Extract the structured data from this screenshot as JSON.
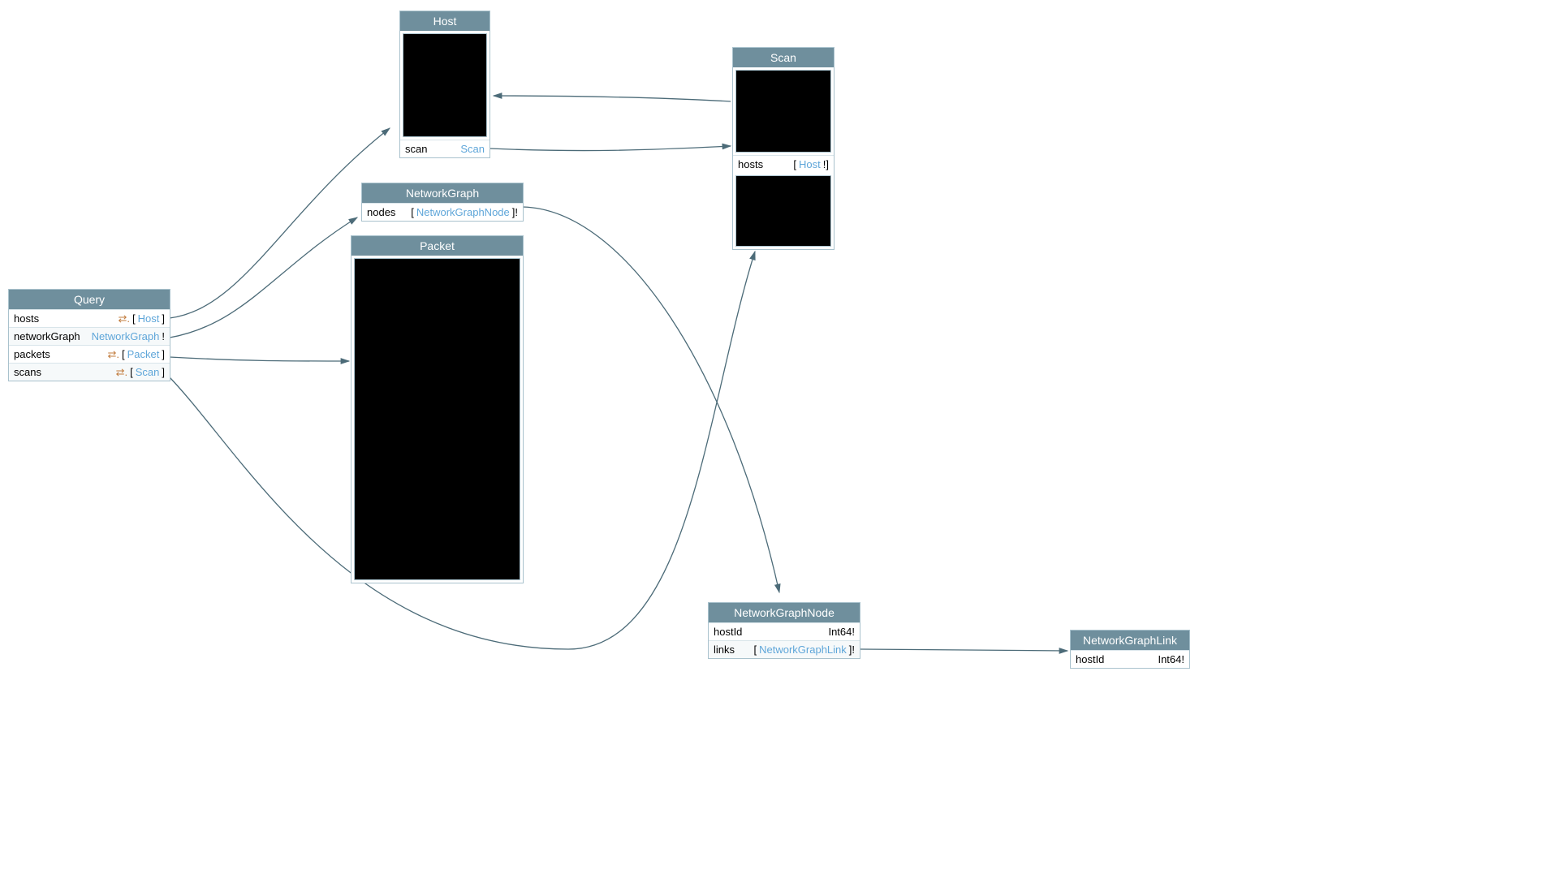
{
  "colors": {
    "header_bg": "#6f8f9d",
    "border": "#a9c2cd",
    "type_link": "#5fa6d9",
    "relay_icon": "#c27c3e",
    "edge": "#4c6b78"
  },
  "nodes": {
    "query": {
      "title": "Query",
      "fields": [
        {
          "name": "hosts",
          "relay": true,
          "type": "Host",
          "wrap": "[ ]"
        },
        {
          "name": "networkGraph",
          "relay": false,
          "type": "NetworkGraph",
          "suffix": "!"
        },
        {
          "name": "packets",
          "relay": true,
          "type": "Packet",
          "wrap": "[ ]"
        },
        {
          "name": "scans",
          "relay": true,
          "type": "Scan",
          "wrap": "[ ]"
        }
      ]
    },
    "host": {
      "title": "Host",
      "fields": [
        {
          "name": "scan",
          "type": "Scan"
        }
      ]
    },
    "scan": {
      "title": "Scan",
      "fields": [
        {
          "name": "hosts",
          "type": "Host",
          "wrap": "[ !]"
        }
      ]
    },
    "networkGraph": {
      "title": "NetworkGraph",
      "fields": [
        {
          "name": "nodes",
          "type": "NetworkGraphNode",
          "wrap": "[ ]!"
        }
      ]
    },
    "packet": {
      "title": "Packet"
    },
    "networkGraphNode": {
      "title": "NetworkGraphNode",
      "fields": [
        {
          "name": "hostId",
          "type_plain": "Int64!"
        },
        {
          "name": "links",
          "type": "NetworkGraphLink",
          "wrap": "[ ]!"
        }
      ]
    },
    "networkGraphLink": {
      "title": "NetworkGraphLink",
      "fields": [
        {
          "name": "hostId",
          "type_plain": "Int64!"
        }
      ]
    }
  }
}
